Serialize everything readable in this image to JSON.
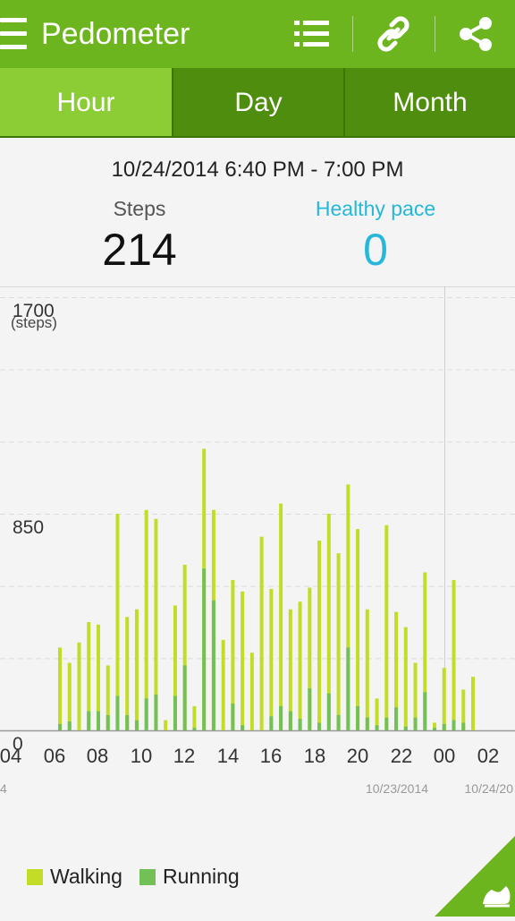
{
  "app": {
    "title": "Pedometer",
    "accent": "#6db51e"
  },
  "toolbar": {
    "icons": [
      "list-icon",
      "link-icon",
      "share-icon"
    ]
  },
  "tabs": [
    {
      "label": "Hour",
      "active": true
    },
    {
      "label": "Day",
      "active": false
    },
    {
      "label": "Month",
      "active": false
    }
  ],
  "summary": {
    "period": "10/24/2014 6:40 PM - 7:00 PM",
    "steps_label": "Steps",
    "steps_value": "214",
    "pace_label": "Healthy pace",
    "pace_value": "0"
  },
  "legend": {
    "walking": "Walking",
    "running": "Running"
  },
  "chart_data": {
    "type": "bar",
    "stacked": true,
    "ylabel": "(steps)",
    "ylim": [
      0,
      1700
    ],
    "yticks": [
      "1700",
      "850",
      "0"
    ],
    "xticks": [
      "04",
      "06",
      "08",
      "10",
      "12",
      "14",
      "16",
      "18",
      "20",
      "22",
      "00",
      "02"
    ],
    "date_labels": [
      "4",
      "10/23/2014",
      "10/24/20"
    ],
    "colors": {
      "walking": "#c3dd26",
      "running": "#72c056"
    },
    "series": [
      {
        "name": "Walking",
        "values": [
          325,
          265,
          345,
          425,
          415,
          255,
          850,
          445,
          475,
          865,
          830,
          40,
          490,
          650,
          95,
          1105,
          865,
          355,
          590,
          545,
          305,
          760,
          555,
          890,
          475,
          505,
          560,
          745,
          850,
          695,
          965,
          790,
          475,
          125,
          805,
          465,
          405,
          265,
          620,
          30,
          245,
          590,
          160,
          210
        ]
      },
      {
        "name": "Running",
        "values": [
          25,
          35,
          0,
          75,
          75,
          60,
          135,
          60,
          40,
          125,
          140,
          0,
          135,
          255,
          10,
          635,
          510,
          0,
          105,
          20,
          0,
          0,
          55,
          95,
          75,
          45,
          165,
          30,
          145,
          60,
          325,
          95,
          50,
          20,
          50,
          90,
          15,
          50,
          150,
          10,
          25,
          40,
          30,
          0
        ]
      }
    ]
  }
}
